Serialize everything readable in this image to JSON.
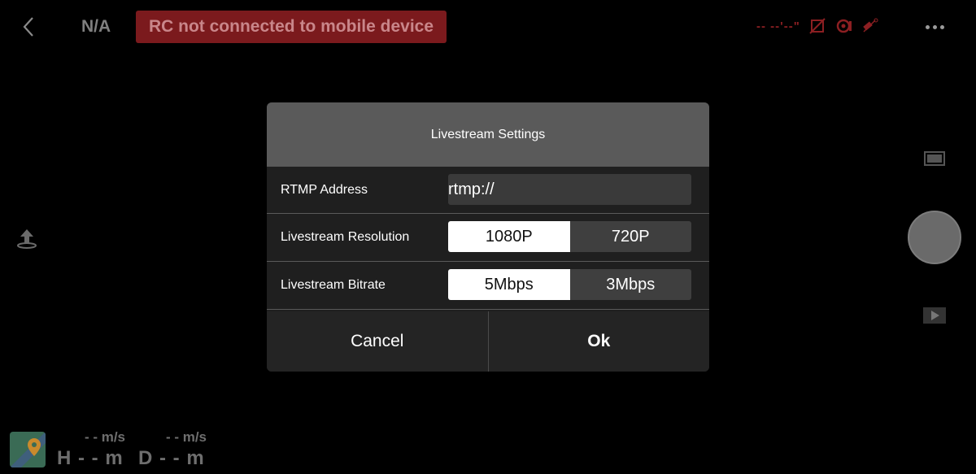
{
  "topbar": {
    "mode": "N/A",
    "warning": "RC not connected to mobile device",
    "status_text": "--  --'--\""
  },
  "telemetry": {
    "h_speed": "- - m/s",
    "h_value": "H - - m",
    "d_speed": "- - m/s",
    "d_value": "D - - m"
  },
  "dialog": {
    "title": "Livestream Settings",
    "rtmp": {
      "label": "RTMP Address",
      "value": "rtmp://"
    },
    "resolution": {
      "label": "Livestream Resolution",
      "options": [
        "1080P",
        "720P"
      ],
      "selected": "1080P"
    },
    "bitrate": {
      "label": "Livestream Bitrate",
      "options": [
        "5Mbps",
        "3Mbps"
      ],
      "selected": "5Mbps"
    },
    "cancel_label": "Cancel",
    "ok_label": "Ok"
  },
  "colors": {
    "warning_bg": "#7b1a1d",
    "status_red": "#8c1f22",
    "dialog_header": "#5a5a5a",
    "dialog_body": "#1f1f1f"
  },
  "icons": [
    "back-chevron-icon",
    "no-sd-card-icon",
    "gimbal-icon",
    "satellite-icon",
    "more-icon",
    "upload-icon",
    "display-icon",
    "playback-icon",
    "map-icon"
  ]
}
